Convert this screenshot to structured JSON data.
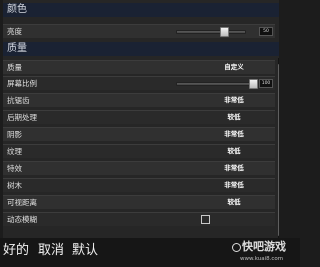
{
  "sections": {
    "color": {
      "title": "颜色",
      "brightness": {
        "label": "亮度",
        "value_text": "50",
        "level": 0.72
      }
    },
    "quality": {
      "title": "质量",
      "rows": [
        {
          "key": "quality",
          "label": "质量",
          "value": "自定义"
        },
        {
          "key": "screen-ratio",
          "label": "屏幕比例",
          "value_text": "100",
          "level": 1.0
        },
        {
          "key": "anti-aliasing",
          "label": "抗锯齿",
          "value": "非常低"
        },
        {
          "key": "post-processing",
          "label": "后期处理",
          "value": "较低"
        },
        {
          "key": "shadows",
          "label": "阴影",
          "value": "非常低"
        },
        {
          "key": "textures",
          "label": "纹理",
          "value": "较低"
        },
        {
          "key": "effects",
          "label": "特效",
          "value": "非常低"
        },
        {
          "key": "foliage",
          "label": "树木",
          "value": "非常低"
        },
        {
          "key": "view-distance",
          "label": "可视距离",
          "value": "较低"
        },
        {
          "key": "motion-blur",
          "label": "动态模糊",
          "checked": false
        }
      ]
    }
  },
  "actions": {
    "ok": "好的",
    "cancel": "取消",
    "default": "默认"
  },
  "watermark": {
    "brand": "快吧游戏",
    "url": "www.kuai8.com"
  },
  "colors": {
    "section_header": "#1a2233",
    "row_bg": "#303030",
    "panel_bg": "#262626"
  }
}
